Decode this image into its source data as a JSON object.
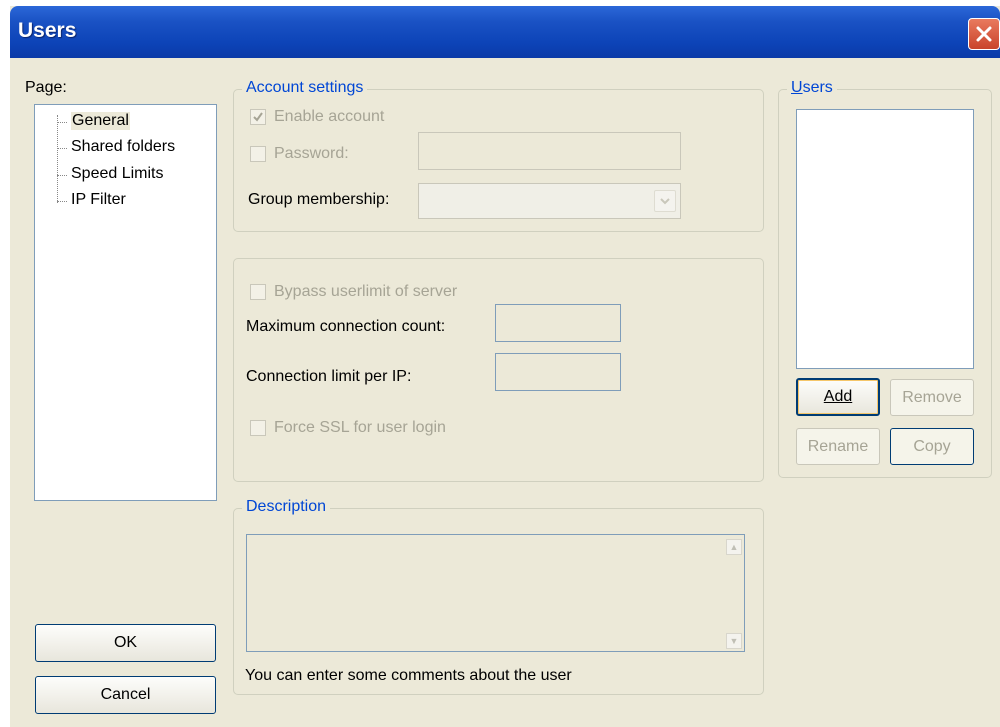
{
  "window": {
    "title": "Users"
  },
  "page_tree": {
    "label": "Page:",
    "items": [
      "General",
      "Shared folders",
      "Speed Limits",
      "IP Filter"
    ]
  },
  "account": {
    "legend": "Account settings",
    "enable_label": "Enable account",
    "enable_checked": true,
    "password_label": "Password:",
    "password_value": "",
    "group_label": "Group membership:",
    "group_value": ""
  },
  "limits": {
    "bypass_label": "Bypass userlimit of server",
    "max_conn_label": "Maximum connection count:",
    "max_conn_value": "",
    "conn_limit_label": "Connection limit per IP:",
    "conn_limit_value": "",
    "force_ssl_label": "Force SSL for user login"
  },
  "description": {
    "legend": "Description",
    "value": "",
    "hint": "You can enter some comments about the user"
  },
  "users": {
    "legend": "Users",
    "items": [],
    "add_label": "Add",
    "remove_label": "Remove",
    "rename_label": "Rename",
    "copy_label": "Copy"
  },
  "buttons": {
    "ok": "OK",
    "cancel": "Cancel"
  }
}
